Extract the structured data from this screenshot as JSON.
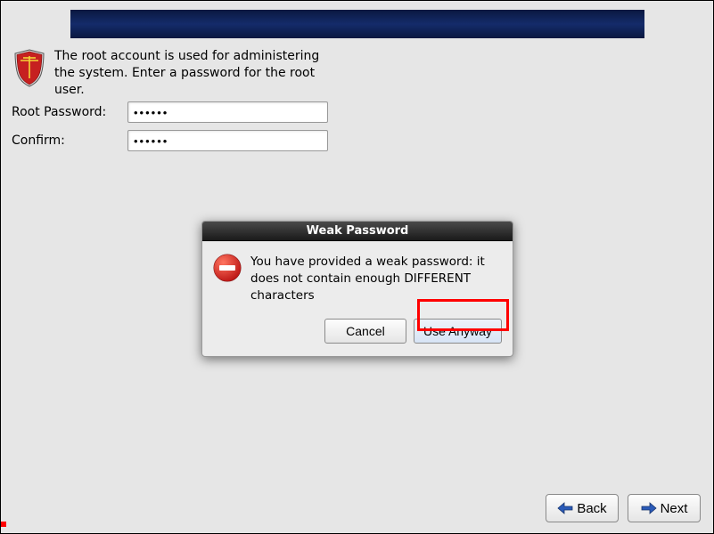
{
  "intro": {
    "text": "The root account is used for administering the system.  Enter a password for the root user."
  },
  "fields": {
    "password_label": "Root Password:",
    "password_value": "••••••",
    "confirm_label": "Confirm:",
    "confirm_value": "••••••"
  },
  "dialog": {
    "title": "Weak Password",
    "message": "You have provided a weak password: it does not contain enough DIFFERENT characters",
    "cancel_label": "Cancel",
    "use_anyway_label": "Use Anyway"
  },
  "nav": {
    "back_label": "Back",
    "next_label": "Next"
  }
}
